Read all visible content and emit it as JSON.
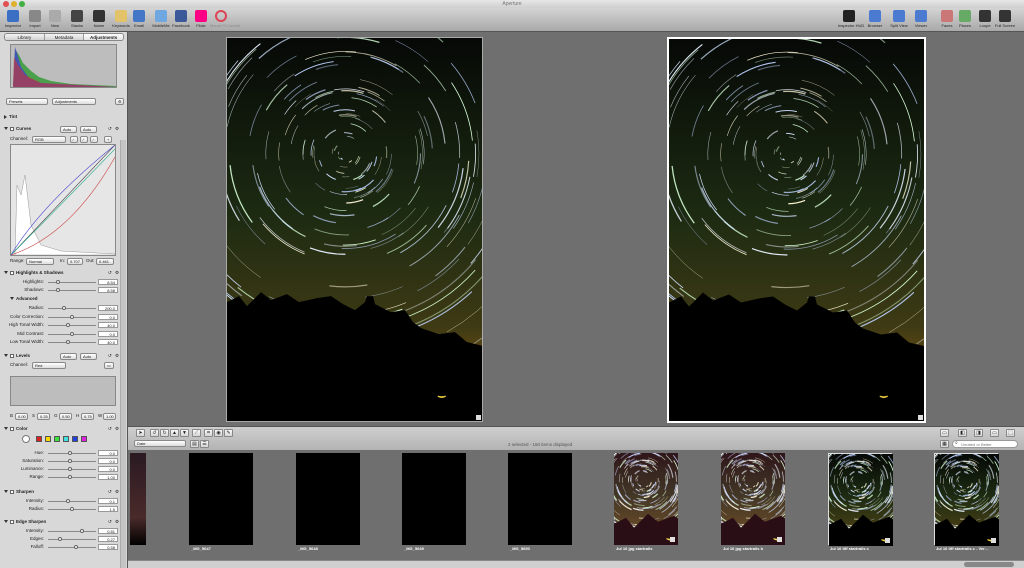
{
  "window": {
    "title": "Aperture"
  },
  "toolbar": {
    "left": [
      {
        "label": "Inspector",
        "icon": "info-icon",
        "color": "#3b6fc4"
      },
      {
        "label": "Import",
        "icon": "import-icon",
        "color": "#888"
      },
      {
        "label": "New",
        "icon": "new-icon",
        "color": "#aaa"
      },
      {
        "label": "Stacks",
        "icon": "stack-icon",
        "color": "#444"
      },
      {
        "label": "Name",
        "icon": "name-icon",
        "color": "#333"
      },
      {
        "label": "Keywords",
        "icon": "keywords-icon",
        "color": "#e3c36a"
      },
      {
        "label": "Email",
        "icon": "email-icon",
        "color": "#4577c7"
      },
      {
        "label": "MobileMe",
        "icon": "mobileme-icon",
        "color": "#6fa8e0"
      },
      {
        "label": "Facebook",
        "icon": "facebook-icon",
        "color": "#3b5998"
      },
      {
        "label": "Flickr",
        "icon": "flickr-icon",
        "color": "#ff0084"
      },
      {
        "label": "Mount Pt Control",
        "icon": "disabled-icon",
        "color": "#d45"
      }
    ],
    "right": [
      {
        "label": "Inspector HUD",
        "icon": "hud-icon",
        "color": "#222"
      },
      {
        "label": "Browser",
        "icon": "browser-icon",
        "color": "#4a7bd0"
      },
      {
        "label": "Split View",
        "icon": "split-view-icon",
        "color": "#4a7bd0"
      },
      {
        "label": "Viewer",
        "icon": "viewer-icon",
        "color": "#4a7bd0"
      },
      {
        "label": "Faces",
        "icon": "faces-icon",
        "color": "#c77"
      },
      {
        "label": "Places",
        "icon": "places-icon",
        "color": "#6a6"
      },
      {
        "label": "Loupe",
        "icon": "loupe-icon",
        "color": "#333"
      },
      {
        "label": "Full Screen",
        "icon": "fullscreen-icon",
        "color": "#333"
      }
    ]
  },
  "inspector": {
    "tabs": [
      "Library",
      "Metadata",
      "Adjustments"
    ],
    "presets": "Presets",
    "adjustments": "Adjustments",
    "tint": "Tint",
    "curves": {
      "title": "Curves",
      "auto": "Auto",
      "auto2": "Auto",
      "channel_label": "Channel:",
      "channel": "RGB",
      "range_label": "Range:",
      "range": "Normal",
      "in_label": "In:",
      "in": "0.707",
      "out_label": "Out:",
      "out": "0.461"
    },
    "highlights_shadows": {
      "title": "Highlights & Shadows",
      "highlights_label": "Highlights:",
      "highlights": "8.54",
      "shadows_label": "Shadows:",
      "shadows": "8.58",
      "advanced": "Advanced",
      "radius_label": "Radius:",
      "radius": "200.0",
      "color_corr_label": "Color Correction:",
      "color_corr": "0.0",
      "high_tonal_label": "High Tonal Width:",
      "high_tonal": "40.0",
      "mid_contrast_label": "Mid Contrast:",
      "mid_contrast": "0.0",
      "low_tonal_label": "Low Tonal Width:",
      "low_tonal": "40.0"
    },
    "levels": {
      "title": "Levels",
      "auto": "Auto",
      "auto2": "Auto",
      "channel_label": "Channel:",
      "channel": "Red",
      "b": "B",
      "b_val": "0.00",
      "s": "S",
      "s_val": "0.25",
      "g": "G",
      "g_val": "0.50",
      "h": "H",
      "h_val": "0.75",
      "w": "W",
      "w_val": "1.00"
    },
    "color": {
      "title": "Color",
      "hue_label": "Hue:",
      "hue": "0.0",
      "sat_label": "Saturation:",
      "sat": "0.0",
      "lum_label": "Luminance:",
      "lum": "0.0",
      "range_label": "Range:",
      "range": "1.00",
      "swatches": [
        "#e02020",
        "#ffd700",
        "#40e040",
        "#40e0e0",
        "#2040e0",
        "#e020e0"
      ]
    },
    "sharpen": {
      "title": "Sharpen",
      "intensity_label": "Intensity:",
      "intensity": "0.1",
      "radius_label": "Radius:",
      "radius": "1.5"
    },
    "edge_sharpen": {
      "title": "Edge Sharpen",
      "intensity_label": "Intensity:",
      "intensity": "0.81",
      "edges_label": "Edges:",
      "edges": "0.27",
      "falloff_label": "Falloff:",
      "falloff": "0.58"
    }
  },
  "browser": {
    "sort": "Date",
    "status": "2 selected - 150 items displayed",
    "search_placeholder": "Unrated or Better"
  },
  "thumbnails": [
    {
      "caption": "",
      "kind": "partial"
    },
    {
      "caption": "_MG_5647",
      "kind": "black"
    },
    {
      "caption": "_MG_5648",
      "kind": "black"
    },
    {
      "caption": "_MG_5649",
      "kind": "black"
    },
    {
      "caption": "_MG_5650",
      "kind": "black"
    },
    {
      "caption": "Jul 16 jpg startrails",
      "kind": "warm"
    },
    {
      "caption": "Jul 16 jpg startrails b",
      "kind": "warm"
    },
    {
      "caption": "Jul 16 tiff startrails c",
      "kind": "star"
    },
    {
      "caption": "Jul 16 tiff startrails c - Ver…",
      "kind": "star"
    }
  ]
}
